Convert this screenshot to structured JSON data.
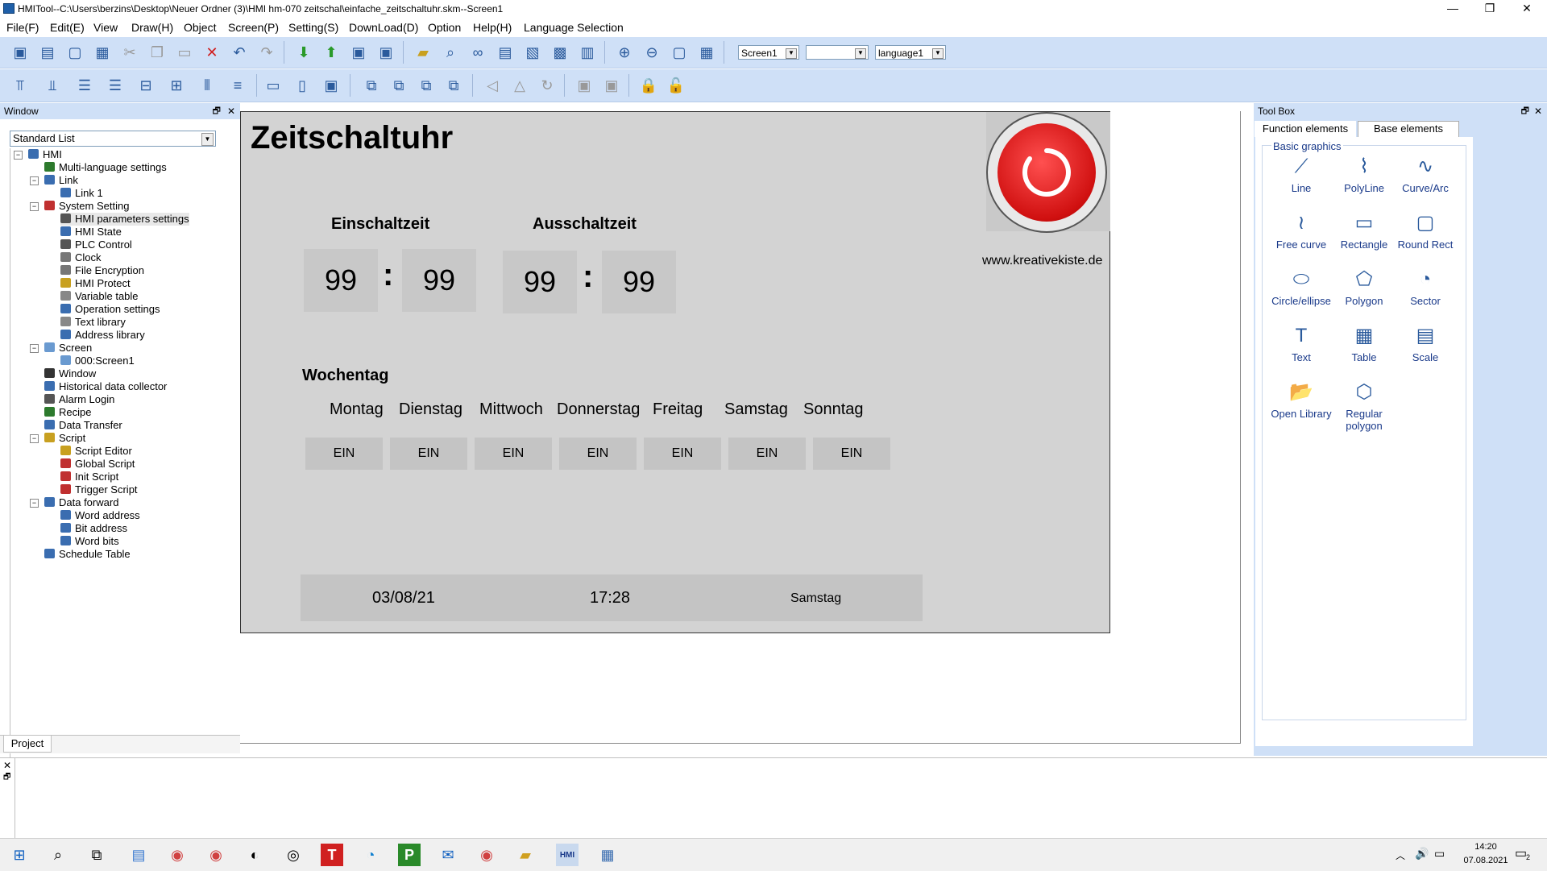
{
  "window": {
    "title": "HMITool--C:\\Users\\berzins\\Desktop\\Neuer Ordner (3)\\HMI hm-070 zeitschal\\einfache_zeitschaltuhr.skm--Screen1",
    "minimize": "—",
    "restore": "❐",
    "close": "✕"
  },
  "menubar": [
    "File(F)",
    "Edit(E)",
    "View",
    "Draw(H)",
    "Object",
    "Screen(P)",
    "Setting(S)",
    "DownLoad(D)",
    "Option",
    "Help(H)",
    "Language Selection"
  ],
  "toolbar": {
    "screen_select": "Screen1",
    "blank_select": "",
    "language_select": "language1"
  },
  "left_panel": {
    "title": "Window",
    "list_select": "Standard List",
    "tree": [
      {
        "label": "HMI",
        "level": 0,
        "exp": "-",
        "icon": "hmi-icon",
        "color": "#3a6db0"
      },
      {
        "label": "Multi-language settings",
        "level": 1,
        "icon": "globe-icon",
        "color": "#2d7a2d"
      },
      {
        "label": "Link",
        "level": 1,
        "exp": "-",
        "icon": "link-icon",
        "color": "#3a6db0"
      },
      {
        "label": "Link 1",
        "level": 2,
        "icon": "link-icon",
        "color": "#3a6db0"
      },
      {
        "label": "System Setting",
        "level": 1,
        "exp": "-",
        "icon": "tools-icon",
        "color": "#c03030"
      },
      {
        "label": "HMI parameters settings",
        "level": 2,
        "icon": "wrench-icon",
        "color": "#555"
      },
      {
        "label": "HMI State",
        "level": 2,
        "icon": "monitor-icon",
        "color": "#3a6db0"
      },
      {
        "label": "PLC Control",
        "level": 2,
        "icon": "plc-icon",
        "color": "#555"
      },
      {
        "label": "Clock",
        "level": 2,
        "icon": "clock-icon",
        "color": "#777"
      },
      {
        "label": "File Encryption",
        "level": 2,
        "icon": "lock-icon",
        "color": "#777"
      },
      {
        "label": "HMI Protect",
        "level": 2,
        "icon": "key-icon",
        "color": "#c8a020"
      },
      {
        "label": "Variable table",
        "level": 2,
        "icon": "table-icon",
        "color": "#888"
      },
      {
        "label": "Operation settings",
        "level": 2,
        "icon": "gear-icon",
        "color": "#3a6db0"
      },
      {
        "label": "Text library",
        "level": 2,
        "icon": "text-icon",
        "color": "#888"
      },
      {
        "label": "Address library",
        "level": 2,
        "icon": "address-icon",
        "color": "#3a6db0"
      },
      {
        "label": "Screen",
        "level": 1,
        "exp": "-",
        "icon": "screen-icon",
        "color": "#6a9ad0"
      },
      {
        "label": "000:Screen1",
        "level": 2,
        "icon": "screen-icon",
        "color": "#6a9ad0"
      },
      {
        "label": "Window",
        "level": 1,
        "icon": "window-icon",
        "color": "#333"
      },
      {
        "label": "Historical data collector",
        "level": 1,
        "icon": "database-icon",
        "color": "#3a6db0"
      },
      {
        "label": "Alarm Login",
        "level": 1,
        "icon": "alarm-icon",
        "color": "#555"
      },
      {
        "label": "Recipe",
        "level": 1,
        "icon": "recipe-icon",
        "color": "#2d7a2d"
      },
      {
        "label": "Data Transfer",
        "level": 1,
        "icon": "transfer-icon",
        "color": "#3a6db0"
      },
      {
        "label": "Script",
        "level": 1,
        "exp": "-",
        "icon": "script-icon",
        "color": "#c8a020"
      },
      {
        "label": "Script Editor",
        "level": 2,
        "icon": "pencil-icon",
        "color": "#c8a020"
      },
      {
        "label": "Global Script",
        "level": 2,
        "icon": "g-script-icon",
        "color": "#c03030"
      },
      {
        "label": "Init Script",
        "level": 2,
        "icon": "i-script-icon",
        "color": "#c03030"
      },
      {
        "label": "Trigger Script",
        "level": 2,
        "icon": "t-script-icon",
        "color": "#c03030"
      },
      {
        "label": "Data forward",
        "level": 1,
        "exp": "-",
        "icon": "forward-icon",
        "color": "#3a6db0"
      },
      {
        "label": "Word address",
        "level": 2,
        "icon": "word-icon",
        "color": "#3a6db0"
      },
      {
        "label": "Bit address",
        "level": 2,
        "icon": "bit-icon",
        "color": "#3a6db0"
      },
      {
        "label": "Word bits",
        "level": 2,
        "icon": "wordbits-icon",
        "color": "#3a6db0"
      },
      {
        "label": "Schedule Table",
        "level": 1,
        "icon": "schedule-icon",
        "color": "#3a6db0"
      }
    ],
    "tab": "Project"
  },
  "hmi_screen": {
    "title": "Zeitschaltuhr",
    "url": "www.kreativekiste.de",
    "on_label": "Einschaltzeit",
    "off_label": "Ausschaltzeit",
    "on_hour": "99",
    "on_min": "99",
    "off_hour": "99",
    "off_min": "99",
    "colon": ":",
    "weekday_label": "Wochentag",
    "days": [
      "Montag",
      "Dienstag",
      "Mittwoch",
      "Donnerstag",
      "Freitag",
      "Samstag",
      "Sonntag"
    ],
    "day_buttons": [
      "EIN",
      "EIN",
      "EIN",
      "EIN",
      "EIN",
      "EIN",
      "EIN"
    ],
    "status_date": "03/08/21",
    "status_time": "17:28",
    "status_day": "Samstag",
    "power_color": "#e02020"
  },
  "toolbox": {
    "title": "Tool Box",
    "tabs": [
      "Function elements",
      "Base elements"
    ],
    "group": "Basic graphics",
    "tools": [
      {
        "label": "Line",
        "icon": "line-icon",
        "glyph": "⟋"
      },
      {
        "label": "PolyLine",
        "icon": "polyline-icon",
        "glyph": "⌇"
      },
      {
        "label": "Curve/Arc",
        "icon": "curve-icon",
        "glyph": "∿"
      },
      {
        "label": "Free curve",
        "icon": "free-curve-icon",
        "glyph": "≀"
      },
      {
        "label": "Rectangle",
        "icon": "rectangle-icon",
        "glyph": "▭"
      },
      {
        "label": "Round Rect",
        "icon": "round-rect-icon",
        "glyph": "▢"
      },
      {
        "label": "Circle/ellipse",
        "icon": "ellipse-icon",
        "glyph": "⬭"
      },
      {
        "label": "Polygon",
        "icon": "polygon-icon",
        "glyph": "⬠"
      },
      {
        "label": "Sector",
        "icon": "sector-icon",
        "glyph": "◔"
      },
      {
        "label": "Text",
        "icon": "text-tool-icon",
        "glyph": "T"
      },
      {
        "label": "Table",
        "icon": "table-tool-icon",
        "glyph": "▦"
      },
      {
        "label": "Scale",
        "icon": "scale-icon",
        "glyph": "▤"
      },
      {
        "label": "Open Library",
        "icon": "folder-icon",
        "glyph": "📂"
      },
      {
        "label": "Regular polygon",
        "icon": "regular-polygon-icon",
        "glyph": "⬡"
      }
    ]
  },
  "taskbar": {
    "time": "14:20",
    "date": "07.08.2021",
    "notif_count": "2"
  }
}
